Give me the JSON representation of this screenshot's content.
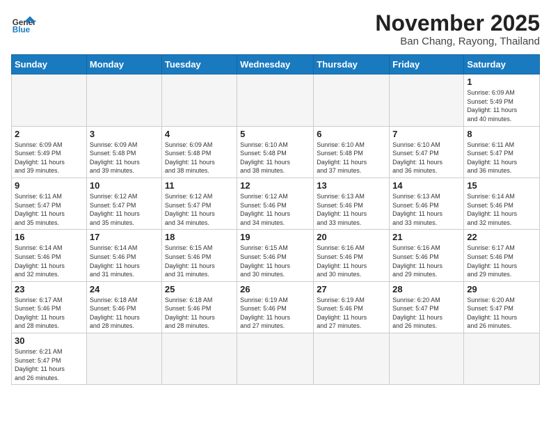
{
  "header": {
    "logo_general": "General",
    "logo_blue": "Blue",
    "month_title": "November 2025",
    "location": "Ban Chang, Rayong, Thailand"
  },
  "weekdays": [
    "Sunday",
    "Monday",
    "Tuesday",
    "Wednesday",
    "Thursday",
    "Friday",
    "Saturday"
  ],
  "weeks": [
    [
      {
        "day": "",
        "info": ""
      },
      {
        "day": "",
        "info": ""
      },
      {
        "day": "",
        "info": ""
      },
      {
        "day": "",
        "info": ""
      },
      {
        "day": "",
        "info": ""
      },
      {
        "day": "",
        "info": ""
      },
      {
        "day": "1",
        "info": "Sunrise: 6:09 AM\nSunset: 5:49 PM\nDaylight: 11 hours\nand 40 minutes."
      }
    ],
    [
      {
        "day": "2",
        "info": "Sunrise: 6:09 AM\nSunset: 5:49 PM\nDaylight: 11 hours\nand 39 minutes."
      },
      {
        "day": "3",
        "info": "Sunrise: 6:09 AM\nSunset: 5:48 PM\nDaylight: 11 hours\nand 39 minutes."
      },
      {
        "day": "4",
        "info": "Sunrise: 6:09 AM\nSunset: 5:48 PM\nDaylight: 11 hours\nand 38 minutes."
      },
      {
        "day": "5",
        "info": "Sunrise: 6:10 AM\nSunset: 5:48 PM\nDaylight: 11 hours\nand 38 minutes."
      },
      {
        "day": "6",
        "info": "Sunrise: 6:10 AM\nSunset: 5:48 PM\nDaylight: 11 hours\nand 37 minutes."
      },
      {
        "day": "7",
        "info": "Sunrise: 6:10 AM\nSunset: 5:47 PM\nDaylight: 11 hours\nand 36 minutes."
      },
      {
        "day": "8",
        "info": "Sunrise: 6:11 AM\nSunset: 5:47 PM\nDaylight: 11 hours\nand 36 minutes."
      }
    ],
    [
      {
        "day": "9",
        "info": "Sunrise: 6:11 AM\nSunset: 5:47 PM\nDaylight: 11 hours\nand 35 minutes."
      },
      {
        "day": "10",
        "info": "Sunrise: 6:12 AM\nSunset: 5:47 PM\nDaylight: 11 hours\nand 35 minutes."
      },
      {
        "day": "11",
        "info": "Sunrise: 6:12 AM\nSunset: 5:47 PM\nDaylight: 11 hours\nand 34 minutes."
      },
      {
        "day": "12",
        "info": "Sunrise: 6:12 AM\nSunset: 5:46 PM\nDaylight: 11 hours\nand 34 minutes."
      },
      {
        "day": "13",
        "info": "Sunrise: 6:13 AM\nSunset: 5:46 PM\nDaylight: 11 hours\nand 33 minutes."
      },
      {
        "day": "14",
        "info": "Sunrise: 6:13 AM\nSunset: 5:46 PM\nDaylight: 11 hours\nand 33 minutes."
      },
      {
        "day": "15",
        "info": "Sunrise: 6:14 AM\nSunset: 5:46 PM\nDaylight: 11 hours\nand 32 minutes."
      }
    ],
    [
      {
        "day": "16",
        "info": "Sunrise: 6:14 AM\nSunset: 5:46 PM\nDaylight: 11 hours\nand 32 minutes."
      },
      {
        "day": "17",
        "info": "Sunrise: 6:14 AM\nSunset: 5:46 PM\nDaylight: 11 hours\nand 31 minutes."
      },
      {
        "day": "18",
        "info": "Sunrise: 6:15 AM\nSunset: 5:46 PM\nDaylight: 11 hours\nand 31 minutes."
      },
      {
        "day": "19",
        "info": "Sunrise: 6:15 AM\nSunset: 5:46 PM\nDaylight: 11 hours\nand 30 minutes."
      },
      {
        "day": "20",
        "info": "Sunrise: 6:16 AM\nSunset: 5:46 PM\nDaylight: 11 hours\nand 30 minutes."
      },
      {
        "day": "21",
        "info": "Sunrise: 6:16 AM\nSunset: 5:46 PM\nDaylight: 11 hours\nand 29 minutes."
      },
      {
        "day": "22",
        "info": "Sunrise: 6:17 AM\nSunset: 5:46 PM\nDaylight: 11 hours\nand 29 minutes."
      }
    ],
    [
      {
        "day": "23",
        "info": "Sunrise: 6:17 AM\nSunset: 5:46 PM\nDaylight: 11 hours\nand 28 minutes."
      },
      {
        "day": "24",
        "info": "Sunrise: 6:18 AM\nSunset: 5:46 PM\nDaylight: 11 hours\nand 28 minutes."
      },
      {
        "day": "25",
        "info": "Sunrise: 6:18 AM\nSunset: 5:46 PM\nDaylight: 11 hours\nand 28 minutes."
      },
      {
        "day": "26",
        "info": "Sunrise: 6:19 AM\nSunset: 5:46 PM\nDaylight: 11 hours\nand 27 minutes."
      },
      {
        "day": "27",
        "info": "Sunrise: 6:19 AM\nSunset: 5:46 PM\nDaylight: 11 hours\nand 27 minutes."
      },
      {
        "day": "28",
        "info": "Sunrise: 6:20 AM\nSunset: 5:47 PM\nDaylight: 11 hours\nand 26 minutes."
      },
      {
        "day": "29",
        "info": "Sunrise: 6:20 AM\nSunset: 5:47 PM\nDaylight: 11 hours\nand 26 minutes."
      }
    ],
    [
      {
        "day": "30",
        "info": "Sunrise: 6:21 AM\nSunset: 5:47 PM\nDaylight: 11 hours\nand 26 minutes."
      },
      {
        "day": "",
        "info": ""
      },
      {
        "day": "",
        "info": ""
      },
      {
        "day": "",
        "info": ""
      },
      {
        "day": "",
        "info": ""
      },
      {
        "day": "",
        "info": ""
      },
      {
        "day": "",
        "info": ""
      }
    ]
  ]
}
